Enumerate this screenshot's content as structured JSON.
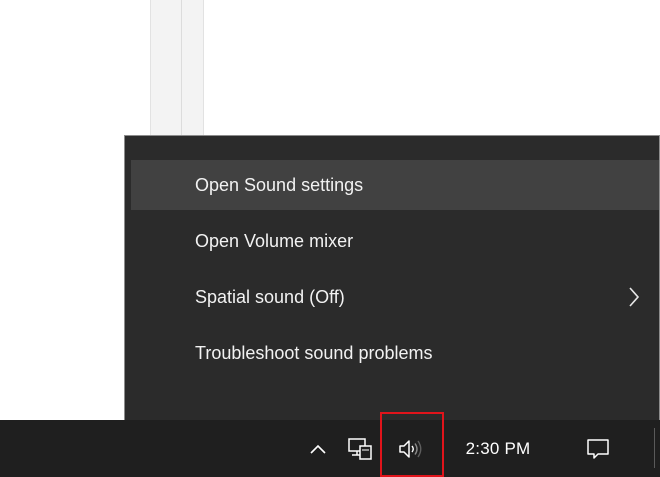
{
  "context_menu": {
    "items": [
      {
        "label": "Open Sound settings",
        "highlighted": true,
        "has_submenu": false
      },
      {
        "label": "Open Volume mixer",
        "highlighted": false,
        "has_submenu": false
      },
      {
        "label": "Spatial sound (Off)",
        "highlighted": false,
        "has_submenu": true
      },
      {
        "label": "Troubleshoot sound problems",
        "highlighted": false,
        "has_submenu": false
      }
    ]
  },
  "taskbar": {
    "tray_icons": [
      "chevron-up-icon",
      "network-icon",
      "volume-icon"
    ],
    "clock": "2:30 PM",
    "notification_icon": "action-center-icon"
  },
  "annotation": {
    "highlight_color": "#e0141b",
    "highlighted_target": "volume-icon"
  }
}
